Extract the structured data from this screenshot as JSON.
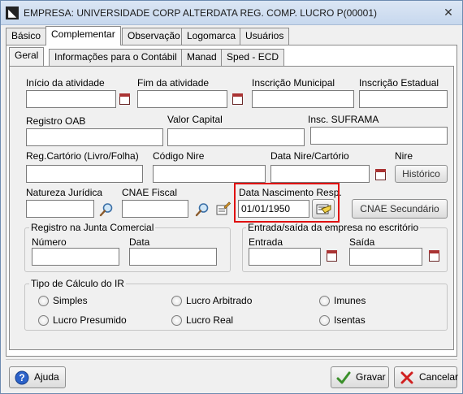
{
  "window": {
    "title": "EMPRESA: UNIVERSIDADE CORP ALTERDATA REG. COMP. LUCRO P(00001)",
    "app_icon": "alterdata-logo-icon",
    "close_glyph": "✕"
  },
  "tabs": [
    "Básico",
    "Complementar",
    "Observação",
    "Logomarca",
    "Usuários"
  ],
  "subtabs": [
    "Geral",
    "Informações para o Contábil",
    "Manad",
    "Sped - ECD"
  ],
  "fields": {
    "inicio_atividade": {
      "label": "Início da atividade",
      "value": ""
    },
    "fim_atividade": {
      "label": "Fim da atividade",
      "value": ""
    },
    "inscricao_municipal": {
      "label": "Inscrição Municipal",
      "value": ""
    },
    "inscricao_estadual": {
      "label": "Inscrição Estadual",
      "value": ""
    },
    "registro_oab": {
      "label": "Registro OAB",
      "value": ""
    },
    "valor_capital": {
      "label": "Valor Capital",
      "value": ""
    },
    "insc_suframa": {
      "label": "Insc. SUFRAMA",
      "value": ""
    },
    "reg_cartorio": {
      "label": "Reg.Cartório (Livro/Folha)",
      "value": ""
    },
    "codigo_nire": {
      "label": "Código Nire",
      "value": ""
    },
    "data_nire": {
      "label": "Data Nire/Cartório",
      "value": ""
    },
    "nire": {
      "label": "Nire"
    },
    "natureza_juridica": {
      "label": "Natureza Jurídica",
      "value": ""
    },
    "cnae_fiscal": {
      "label": "CNAE Fiscal",
      "value": ""
    },
    "data_nascimento_resp": {
      "label": "Data Nascimento Resp.",
      "value": "01/01/1950"
    }
  },
  "buttons": {
    "historico": "Histórico",
    "cnae_secundario": "CNAE Secundário",
    "ajuda": "Ajuda",
    "gravar": "Gravar",
    "cancelar": "Cancelar"
  },
  "registro_junta": {
    "title": "Registro na Junta Comercial",
    "numero_label": "Número",
    "data_label": "Data",
    "numero_value": "",
    "data_value": ""
  },
  "entrada_saida": {
    "title": "Entrada/saída da empresa no escritório",
    "entrada_label": "Entrada",
    "saida_label": "Saída",
    "entrada_value": "",
    "saida_value": ""
  },
  "tipo_calculo": {
    "title": "Tipo de Cálculo do IR",
    "options": [
      "Simples",
      "Lucro Arbitrado",
      "Imunes",
      "Lucro Presumido",
      "Lucro Real",
      "Isentas"
    ]
  },
  "colors": {
    "highlight": "#e01010",
    "accent": "#3a8f2a"
  }
}
